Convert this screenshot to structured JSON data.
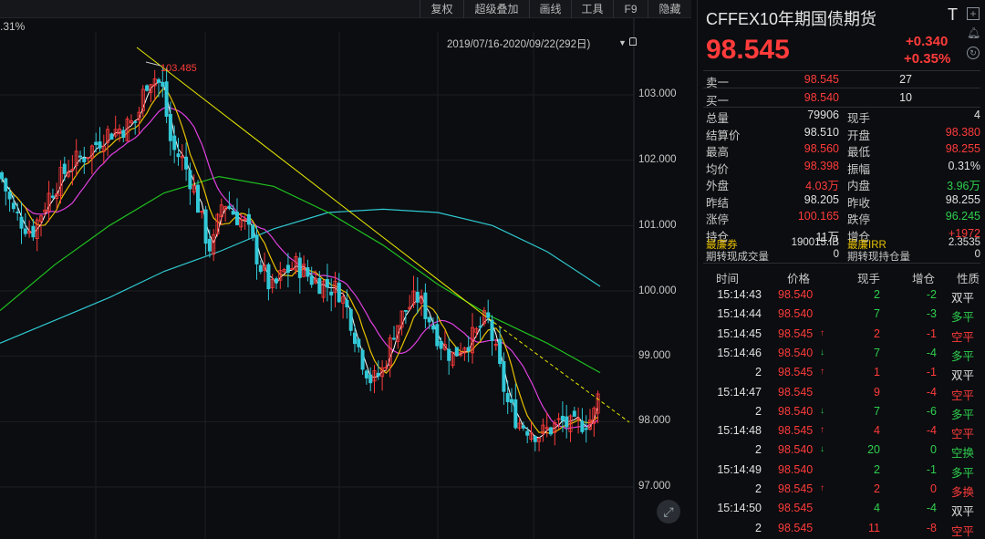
{
  "toolbar": {
    "buttons": [
      "复权",
      "超级叠加",
      "画线",
      "工具",
      "F9",
      "隐藏"
    ]
  },
  "chart": {
    "top_left_percent": ".31%",
    "date_range": "2019/07/16-2020/09/22(292日)",
    "high_marker": "103.485",
    "y_ticks": [
      "103.000",
      "102.000",
      "101.000",
      "100.000",
      "99.000",
      "98.000",
      "97.000"
    ],
    "colors": {
      "up": "#ff3b3b",
      "down": "#33c8d8",
      "ma5": "#ffffff",
      "ma10": "#e8c000",
      "ma20": "#e040e0",
      "ma60": "#20c020",
      "ma120": "#30c8d0",
      "trend": "#e8e800"
    }
  },
  "quote": {
    "title": "CFFEX10年期国债期货",
    "title_suffix": "T",
    "last_price": "98.545",
    "change": "+0.340",
    "change_pct": "+0.35%",
    "sell1": {
      "label": "卖一",
      "price": "98.545",
      "vol": "27"
    },
    "buy1": {
      "label": "买一",
      "price": "98.540",
      "vol": "10"
    },
    "stats": [
      {
        "l1": "总量",
        "v1": "79906",
        "c1": "white",
        "l2": "现手",
        "v2": "4",
        "c2": "white"
      },
      {
        "l1": "结算价",
        "v1": "98.510",
        "c1": "white",
        "l2": "开盘",
        "v2": "98.380",
        "c2": "red"
      },
      {
        "l1": "最高",
        "v1": "98.560",
        "c1": "red",
        "l2": "最低",
        "v2": "98.255",
        "c2": "red"
      },
      {
        "l1": "均价",
        "v1": "98.398",
        "c1": "red",
        "l2": "振幅",
        "v2": "0.31%",
        "c2": "white"
      },
      {
        "l1": "外盘",
        "v1": "4.03万",
        "c1": "red",
        "l2": "内盘",
        "v2": "3.96万",
        "c2": "green"
      },
      {
        "l1": "昨结",
        "v1": "98.205",
        "c1": "white",
        "l2": "昨收",
        "v2": "98.255",
        "c2": "white"
      },
      {
        "l1": "涨停",
        "v1": "100.165",
        "c1": "red",
        "l2": "跌停",
        "v2": "96.245",
        "c2": "green"
      },
      {
        "l1": "持仓",
        "v1": "11万",
        "c1": "white",
        "l2": "增仓",
        "v2": "+1972",
        "c2": "red"
      }
    ],
    "extra": [
      {
        "l1": "最廉券",
        "v1": "190015.IB",
        "l2": "最廉IRR",
        "v2": "2.3535"
      },
      {
        "l1": "期转现成交量",
        "v1": "0",
        "l2": "期转现持仓量",
        "v2": "0"
      }
    ]
  },
  "ticks": {
    "headers": [
      "时间",
      "价格",
      "现手",
      "增仓",
      "性质"
    ],
    "rows": [
      {
        "time": "15:14:43",
        "price": "98.540",
        "arrow": "",
        "vol": "2",
        "oi": "-2",
        "nature": "双平",
        "nc": "white",
        "pc": "red",
        "vc": "green"
      },
      {
        "time": "15:14:44",
        "price": "98.540",
        "arrow": "",
        "vol": "7",
        "oi": "-3",
        "nature": "多平",
        "nc": "green",
        "pc": "red",
        "vc": "green"
      },
      {
        "time": "15:14:45",
        "price": "98.545",
        "arrow": "up",
        "vol": "2",
        "oi": "-1",
        "nature": "空平",
        "nc": "red",
        "pc": "red",
        "vc": "red"
      },
      {
        "time": "15:14:46",
        "price": "98.540",
        "arrow": "down",
        "vol": "7",
        "oi": "-4",
        "nature": "多平",
        "nc": "green",
        "pc": "red",
        "vc": "green"
      },
      {
        "time": "2",
        "price": "98.545",
        "arrow": "up",
        "vol": "1",
        "oi": "-1",
        "nature": "双平",
        "nc": "white",
        "pc": "red",
        "vc": "red"
      },
      {
        "time": "15:14:47",
        "price": "98.545",
        "arrow": "",
        "vol": "9",
        "oi": "-4",
        "nature": "空平",
        "nc": "red",
        "pc": "red",
        "vc": "red"
      },
      {
        "time": "2",
        "price": "98.540",
        "arrow": "down",
        "vol": "7",
        "oi": "-6",
        "nature": "多平",
        "nc": "green",
        "pc": "red",
        "vc": "green"
      },
      {
        "time": "15:14:48",
        "price": "98.545",
        "arrow": "up",
        "vol": "4",
        "oi": "-4",
        "nature": "空平",
        "nc": "red",
        "pc": "red",
        "vc": "red"
      },
      {
        "time": "2",
        "price": "98.540",
        "arrow": "down",
        "vol": "20",
        "oi": "0",
        "nature": "空换",
        "nc": "green",
        "pc": "red",
        "vc": "green"
      },
      {
        "time": "15:14:49",
        "price": "98.540",
        "arrow": "",
        "vol": "2",
        "oi": "-1",
        "nature": "多平",
        "nc": "green",
        "pc": "red",
        "vc": "green"
      },
      {
        "time": "2",
        "price": "98.545",
        "arrow": "up",
        "vol": "2",
        "oi": "0",
        "nature": "多换",
        "nc": "red",
        "pc": "red",
        "vc": "red"
      },
      {
        "time": "15:14:50",
        "price": "98.545",
        "arrow": "",
        "vol": "4",
        "oi": "-4",
        "nature": "双平",
        "nc": "white",
        "pc": "red",
        "vc": "green"
      },
      {
        "time": "2",
        "price": "98.545",
        "arrow": "",
        "vol": "11",
        "oi": "-8",
        "nature": "空平",
        "nc": "red",
        "pc": "red",
        "vc": "red"
      }
    ]
  }
}
